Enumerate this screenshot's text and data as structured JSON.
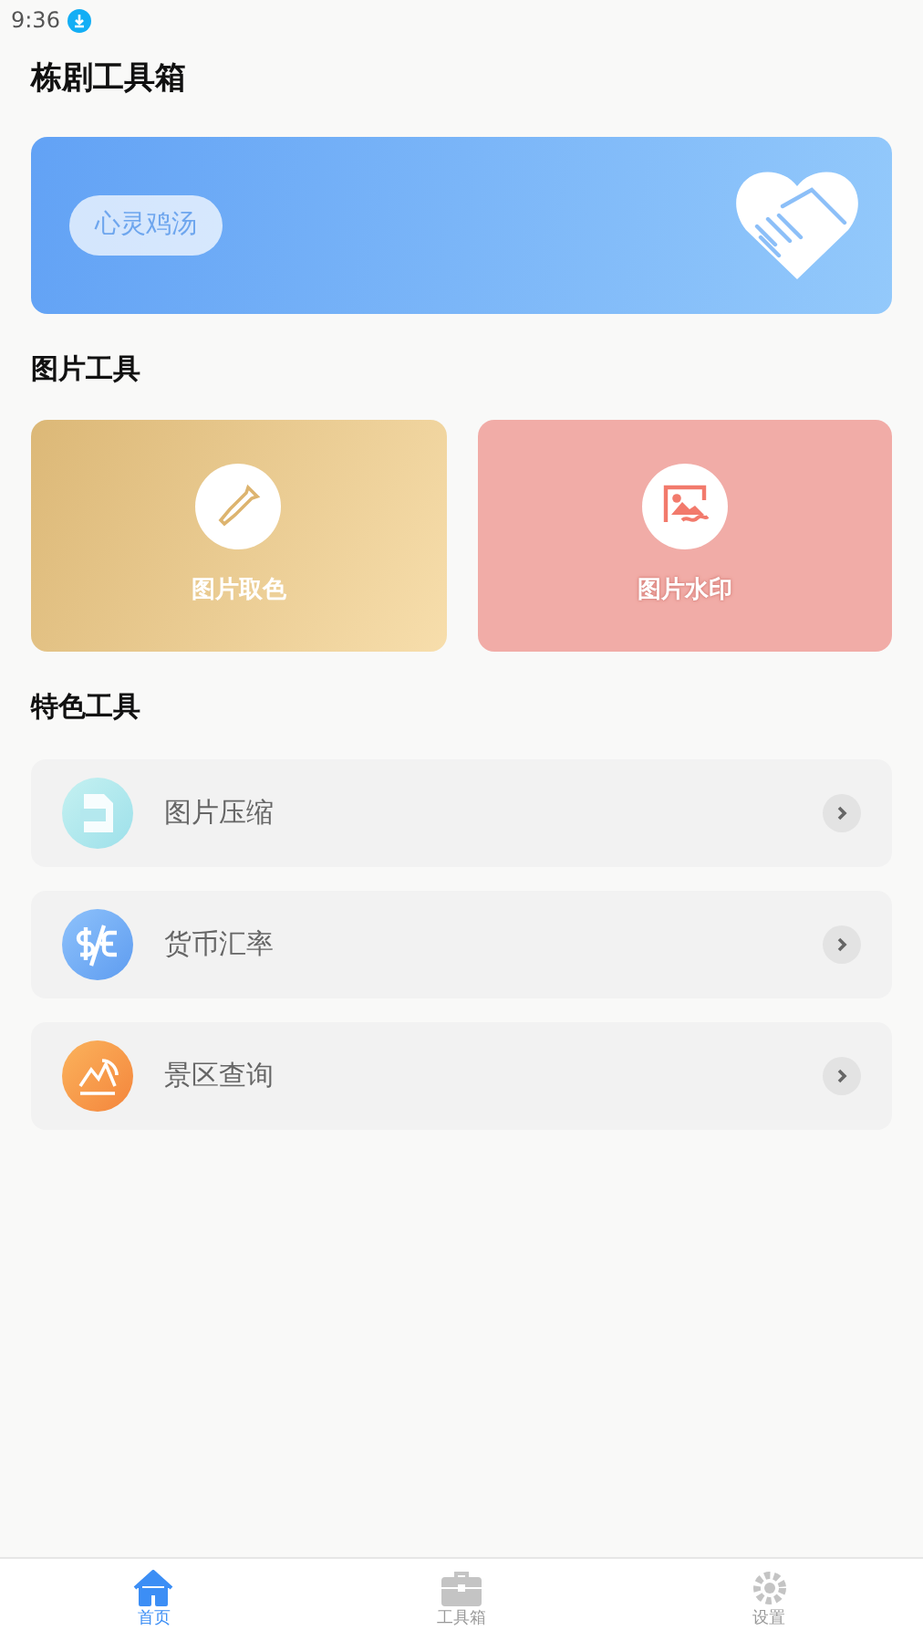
{
  "status_bar": {
    "time": "9:36"
  },
  "title": "栋剧工具箱",
  "banner": {
    "tag": "心灵鸡汤"
  },
  "image_tools": {
    "heading": "图片工具",
    "cards": [
      {
        "kind": "picker",
        "label": "图片取色"
      },
      {
        "kind": "watermark",
        "label": "图片水印"
      }
    ]
  },
  "feature_tools": {
    "heading": "特色工具",
    "items": [
      {
        "kind": "compress",
        "label": "图片压缩"
      },
      {
        "kind": "currency",
        "label": "货币汇率"
      },
      {
        "kind": "scenic",
        "label": "景区查询"
      }
    ]
  },
  "tab_bar": [
    {
      "kind": "home",
      "label": "首页",
      "selected": true
    },
    {
      "kind": "toolbox",
      "label": "工具箱",
      "selected": false
    },
    {
      "kind": "settings",
      "label": "设置",
      "selected": false
    }
  ]
}
